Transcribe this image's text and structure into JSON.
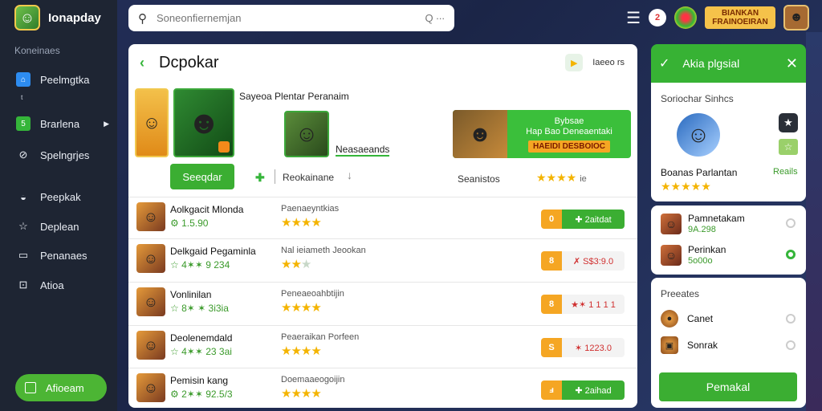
{
  "app": {
    "name": "Ionapday",
    "logo_icon": "gamepad-icon"
  },
  "sidebar": {
    "section_label": "Koneinaes",
    "items": [
      {
        "label": "Peelmgtka",
        "icon": "home-icon"
      },
      {
        "label": "Brarlena",
        "icon": "grid-icon"
      },
      {
        "label": "Spelngrjes",
        "icon": "compass-icon"
      },
      {
        "label": "Peepkak",
        "icon": "shield-icon"
      },
      {
        "label": "Deplean",
        "icon": "star-icon"
      },
      {
        "label": "Penanaes",
        "icon": "document-icon"
      },
      {
        "label": "Atioa",
        "icon": "info-icon"
      }
    ],
    "sub_item": "ᵗ",
    "bottom_button": "Afioeam"
  },
  "topbar": {
    "search_placeholder": "Soneonfiernemjan",
    "search_suffix": "Q ∙∙∙",
    "notif_count": "2",
    "promo_line1": "BIANKAN",
    "promo_line2": "FRAINOEIRAN"
  },
  "main": {
    "title": "Dcpokar",
    "head_right_label": "Iaeeo rs",
    "featured": {
      "caption": "Sayeoa Plentar Peranaim",
      "mid_label": "Neasaeands",
      "banner_line1": "Bybsae",
      "banner_line2": "Hap Bao Deneaentaki",
      "banner_ribbon": "HAEIDI DESBOIOC"
    },
    "controls": {
      "search_button": "Seeqdar",
      "plus": "✚",
      "label": "Reokainane",
      "down": "↓",
      "label2": "Seanistos",
      "stars": "★★★★",
      "stars_value": "ie"
    },
    "rows": [
      {
        "name": "Aolkgacit Mlonda",
        "rating": "⚙ 1.5.90",
        "category": "Paenaeyntkias",
        "stars": "★★★★",
        "stars_dim": "",
        "lead": "0",
        "price": "✚ 2aitdat",
        "price_style": "green"
      },
      {
        "name": "Delkgaid Pegaminla",
        "rating": "☆ 4✶✶ 9 234",
        "category": "Nal ieiameth Jeookan",
        "stars": "★★",
        "stars_dim": "★",
        "lead": "8",
        "price": "✗ S$3:9.0",
        "price_style": "light"
      },
      {
        "name": "Vonlinilan",
        "rating": "☆ 8✶ ✶ 3i3ia",
        "category": "Peneaeoahbtijin",
        "stars": "★★★★",
        "stars_dim": "",
        "lead": "8",
        "price": "★✶ 1 1 1 1",
        "price_style": "light"
      },
      {
        "name": "Deolenemdald",
        "rating": "☆ 4✶✶ 23 3ai",
        "category": "Peaeraikan Porfeen",
        "stars": "★★★★",
        "stars_dim": "",
        "lead": "S",
        "price": "✶ 1223.0",
        "price_style": "light"
      },
      {
        "name": "Pemisin kang",
        "rating": "⚙ 2✶✶ 92.5/3",
        "category": "Doemaaeogoijin",
        "stars": "★★★★",
        "stars_dim": "",
        "lead": "ⅎ",
        "price": "✚ 2aihad",
        "price_style": "green"
      }
    ]
  },
  "right_panel": {
    "title": "Akia plgsial",
    "card1": {
      "subtitle": "Soriochar Sinhcs",
      "name": "Boanas Parlantan",
      "link": "Reails",
      "stars": "★★★★★"
    },
    "card2": [
      {
        "name": "Pamnetakam",
        "value": "9A.298",
        "selected": false
      },
      {
        "name": "Perinkan",
        "value": "5o00o",
        "selected": true
      }
    ],
    "card3": {
      "subtitle": "Preeates",
      "items": [
        {
          "name": "Canet",
          "selected": false
        },
        {
          "name": "Sonrak",
          "selected": false
        }
      ],
      "button": "Pemakal"
    }
  },
  "colors": {
    "accent_green": "#37b234",
    "sidebar_bg": "#1e2533",
    "star": "#f4b400",
    "price_lead": "#f5a623"
  }
}
